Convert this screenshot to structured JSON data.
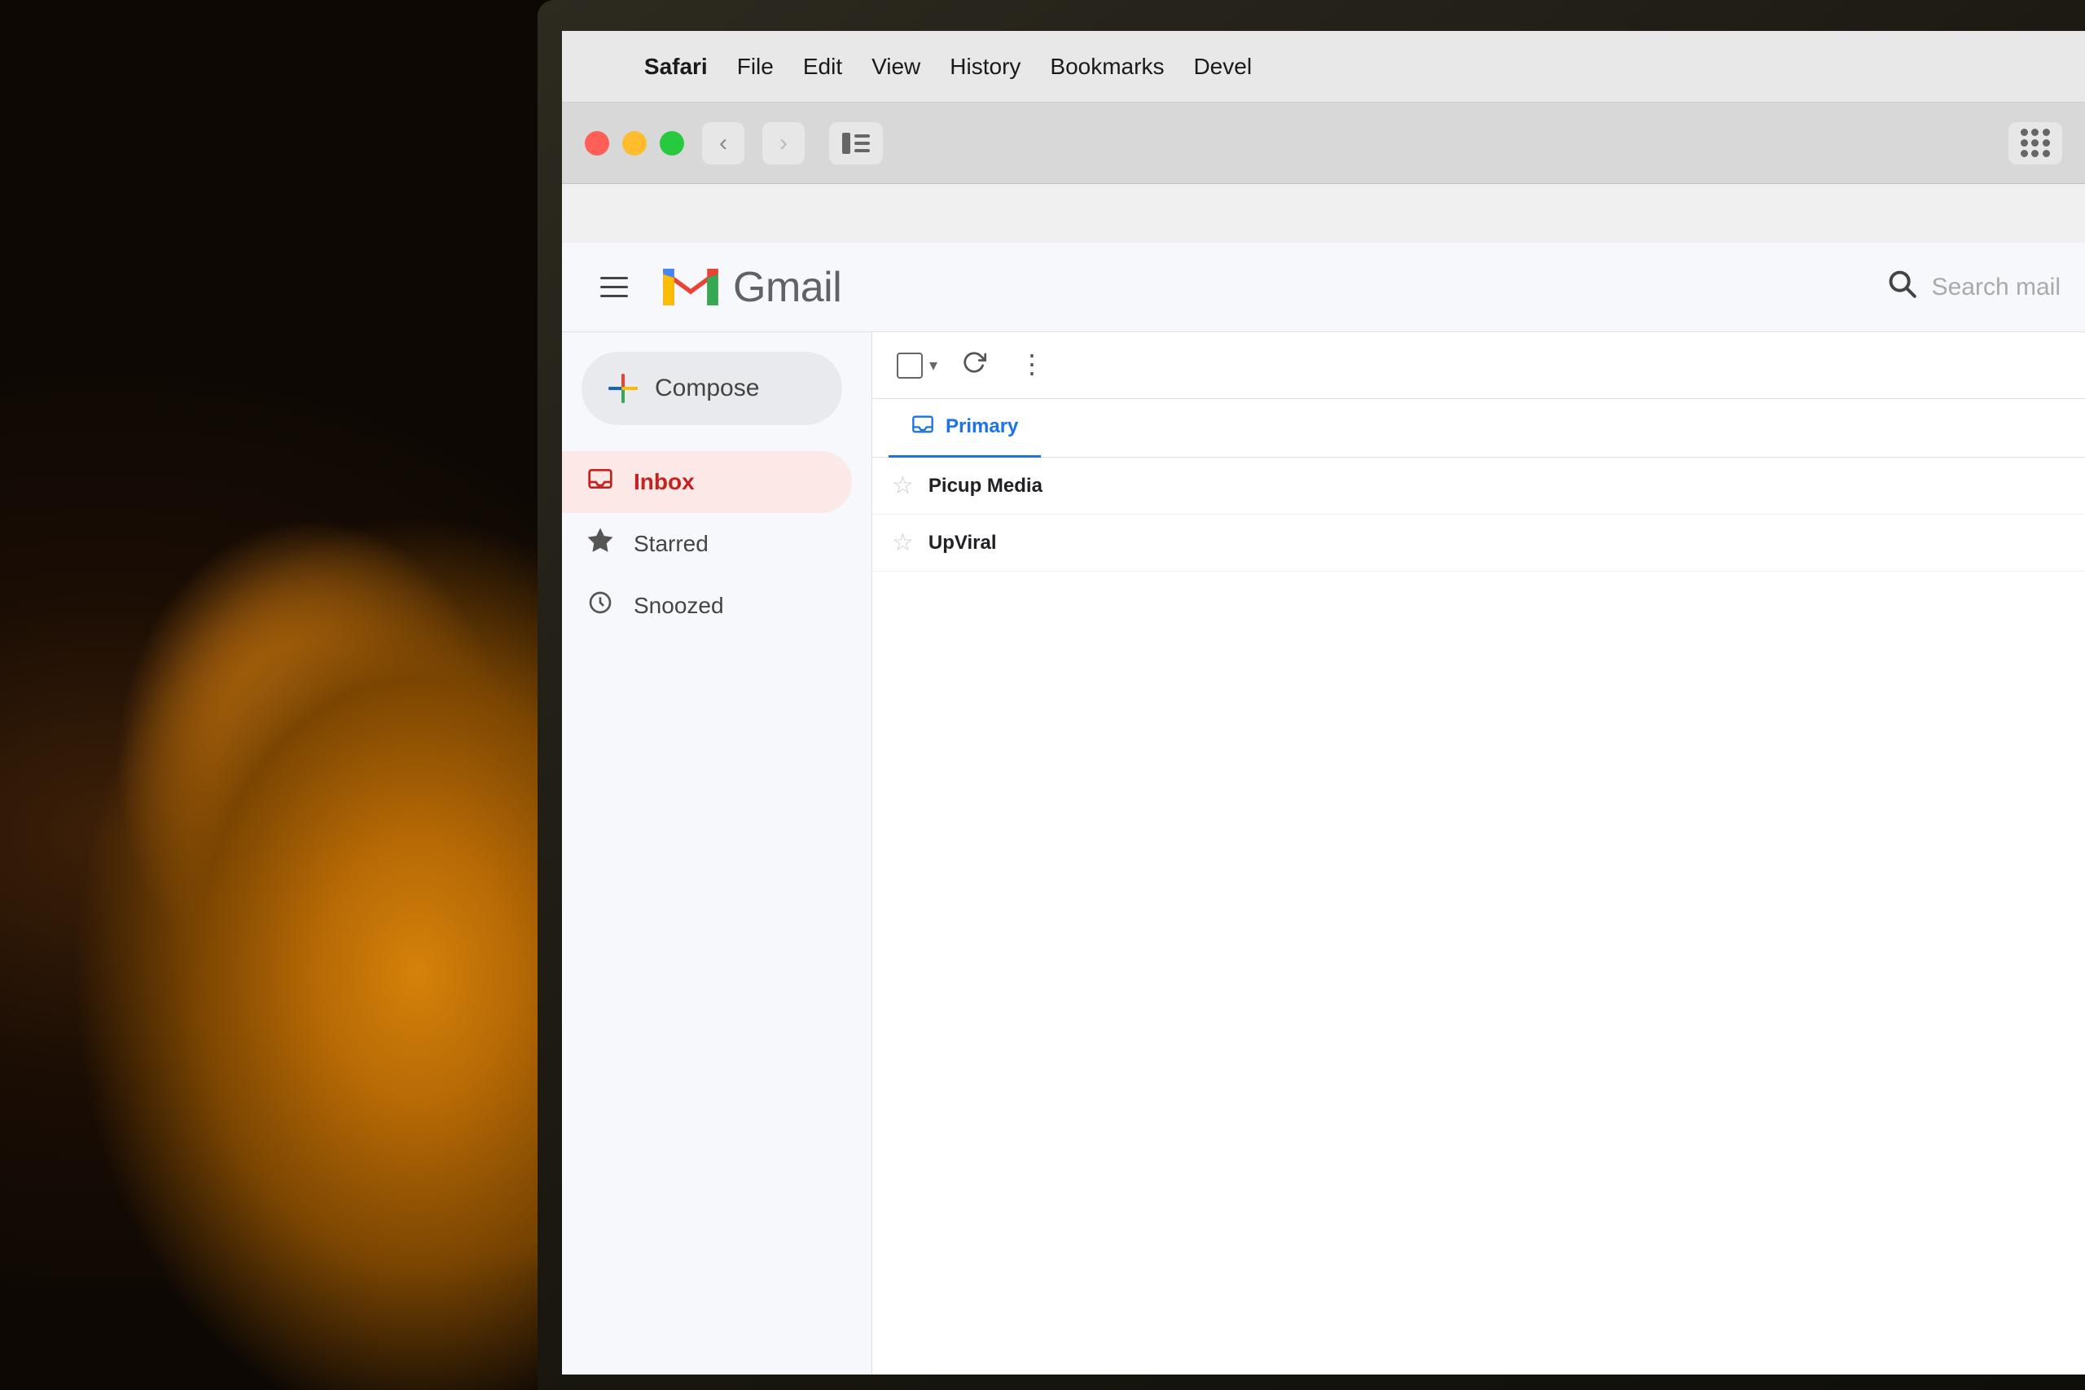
{
  "background": {
    "color": "#1a1008"
  },
  "menubar": {
    "items": [
      "Safari",
      "File",
      "Edit",
      "View",
      "History",
      "Bookmarks",
      "Devel"
    ]
  },
  "browser": {
    "traffic_lights": {
      "close_label": "close",
      "minimize_label": "minimize",
      "maximize_label": "maximize"
    },
    "nav": {
      "back_label": "back",
      "forward_label": "forward"
    },
    "sidebar_toggle_label": "sidebar toggle",
    "grid_icon_label": "tab grid"
  },
  "gmail": {
    "header": {
      "hamburger_label": "menu",
      "logo_m": "M",
      "logo_text": "Gmail",
      "search_placeholder": "Search mail",
      "search_icon_label": "search"
    },
    "sidebar": {
      "compose_label": "Compose",
      "compose_icon_label": "compose plus icon",
      "nav_items": [
        {
          "id": "inbox",
          "label": "Inbox",
          "icon": "inbox",
          "active": true
        },
        {
          "id": "starred",
          "label": "Starred",
          "icon": "star",
          "active": false
        },
        {
          "id": "snoozed",
          "label": "Snoozed",
          "icon": "clock",
          "active": false
        }
      ]
    },
    "toolbar": {
      "checkbox_label": "select all",
      "refresh_label": "refresh",
      "more_label": "more options"
    },
    "tabs": [
      {
        "id": "primary",
        "label": "Primary",
        "icon": "inbox",
        "active": true
      }
    ],
    "emails": [
      {
        "sender": "Picup Media",
        "starred": false
      },
      {
        "sender": "UpViral",
        "starred": false
      }
    ]
  }
}
